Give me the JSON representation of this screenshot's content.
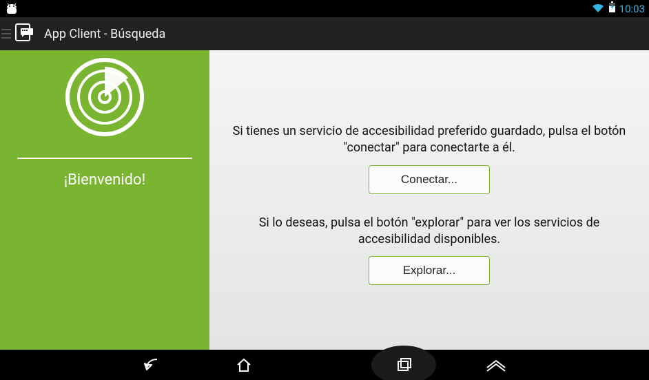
{
  "status_bar": {
    "time": "10:03"
  },
  "action_bar": {
    "title": "App Client - Búsqueda"
  },
  "side_panel": {
    "welcome": "¡Bienvenido!"
  },
  "main_panel": {
    "connect_instruction": "Si tienes un servicio de accesibilidad preferido guardado, pulsa el botón \"conectar\" para conectarte a él.",
    "connect_button": "Conectar...",
    "explore_instruction": "Si lo deseas, pulsa el botón \"explorar\" para ver los servicios de accesibilidad disponibles.",
    "explore_button": "Explorar..."
  }
}
